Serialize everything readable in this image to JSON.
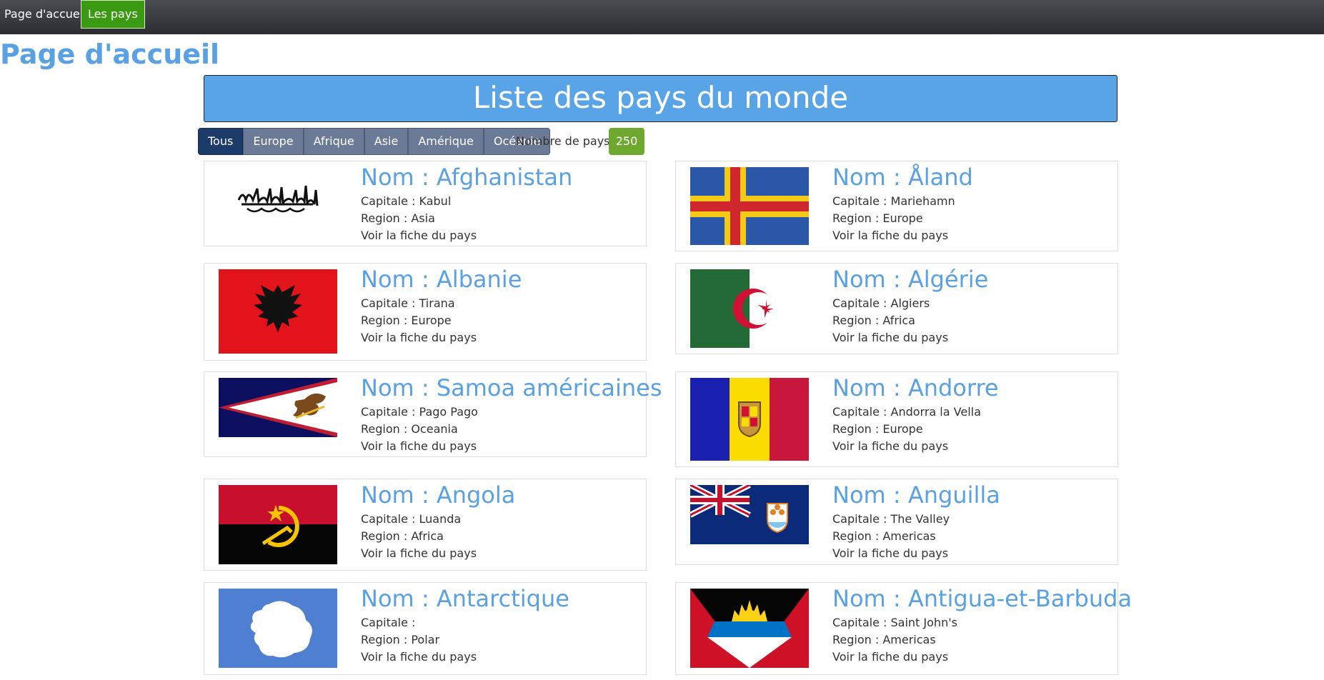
{
  "nav": {
    "home": "Page d'accueil",
    "countries": "Les pays"
  },
  "page_title": "Page d'accueil",
  "banner": "Liste des pays du monde",
  "filters": [
    "Tous",
    "Europe",
    "Afrique",
    "Asie",
    "Amérique",
    "Océanie"
  ],
  "count": {
    "label": "Nombre de pays :",
    "value": "250"
  },
  "cards": [
    {
      "name": "Nom : Afghanistan",
      "capital": "Capitale : Kabul",
      "region": "Region : Asia",
      "link": "Voir la fiche du pays"
    },
    {
      "name": "Nom : Åland",
      "capital": "Capitale : Mariehamn",
      "region": "Region : Europe",
      "link": "Voir la fiche du pays"
    },
    {
      "name": "Nom : Albanie",
      "capital": "Capitale : Tirana",
      "region": "Region : Europe",
      "link": "Voir la fiche du pays"
    },
    {
      "name": "Nom : Algérie",
      "capital": "Capitale : Algiers",
      "region": "Region : Africa",
      "link": "Voir la fiche du pays"
    },
    {
      "name": "Nom : Samoa américaines",
      "capital": "Capitale : Pago Pago",
      "region": "Region : Oceania",
      "link": "Voir la fiche du pays"
    },
    {
      "name": "Nom : Andorre",
      "capital": "Capitale : Andorra la Vella",
      "region": "Region : Europe",
      "link": "Voir la fiche du pays"
    },
    {
      "name": "Nom : Angola",
      "capital": "Capitale : Luanda",
      "region": "Region : Africa",
      "link": "Voir la fiche du pays"
    },
    {
      "name": "Nom : Anguilla",
      "capital": "Capitale : The Valley",
      "region": "Region : Americas",
      "link": "Voir la fiche du pays"
    },
    {
      "name": "Nom : Antarctique",
      "capital": "Capitale :",
      "region": "Region : Polar",
      "link": "Voir la fiche du pays"
    },
    {
      "name": "Nom : Antigua-et-Barbuda",
      "capital": "Capitale : Saint John's",
      "region": "Region : Americas",
      "link": "Voir la fiche du pays"
    }
  ]
}
